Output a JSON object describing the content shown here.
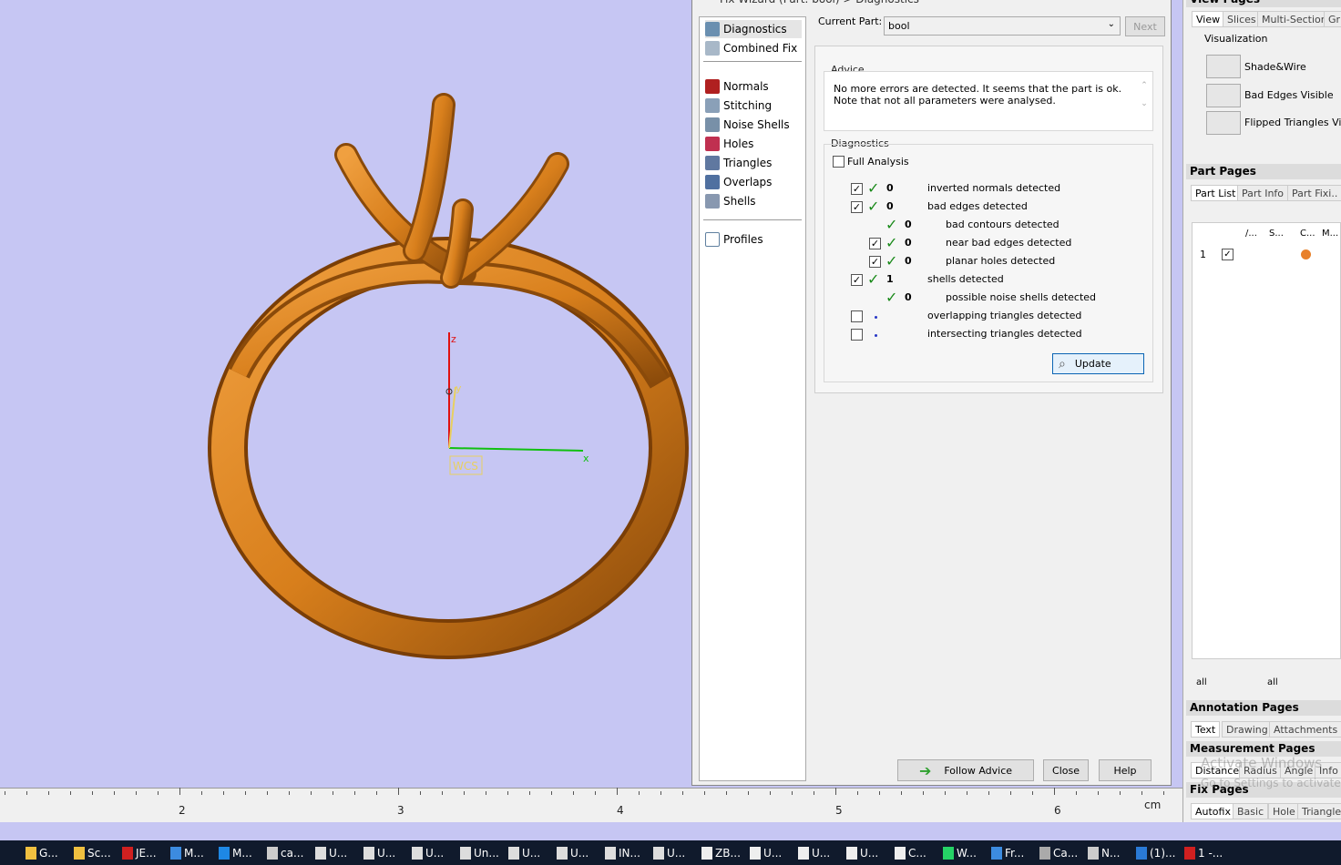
{
  "viewport": {
    "wcs_label": "WCS",
    "axis_x": "x",
    "axis_y": "y",
    "axis_z": "z",
    "ruler_labels": [
      "2",
      "3",
      "4",
      "5",
      "6"
    ],
    "ruler_unit": "cm"
  },
  "wizard": {
    "title": "Fix Wizard (Part: bool) > Diagnostics",
    "nav": [
      "Diagnostics",
      "Combined Fix",
      "Normals",
      "Stitching",
      "Noise Shells",
      "Holes",
      "Triangles",
      "Overlaps",
      "Shells",
      "Profiles"
    ],
    "current_part_label": "Current Part:",
    "current_part_value": "bool",
    "next_label": "Next",
    "advice_label": "Advice",
    "advice_text": "No more errors are detected. It seems that the part is ok. Note that not all parameters were analysed.",
    "diagnostics_label": "Diagnostics",
    "full_analysis_label": "Full Analysis",
    "rows": [
      {
        "count": "0",
        "label": "inverted normals detected"
      },
      {
        "count": "0",
        "label": "bad edges detected"
      },
      {
        "count": "0",
        "label": "bad contours detected"
      },
      {
        "count": "0",
        "label": "near bad edges detected"
      },
      {
        "count": "0",
        "label": "planar holes detected"
      },
      {
        "count": "1",
        "label": "shells detected"
      },
      {
        "count": "0",
        "label": "possible noise shells detected"
      },
      {
        "count": "",
        "label": "overlapping triangles detected"
      },
      {
        "count": "",
        "label": "intersecting triangles detected"
      }
    ],
    "update_label": "Update",
    "follow_advice_label": "Follow Advice",
    "close_label": "Close",
    "help_label": "Help"
  },
  "right": {
    "view_pages": "View Pages",
    "view_tabs": [
      "View",
      "Slices",
      "Multi-Section",
      "Gri"
    ],
    "visualization_label": "Visualization",
    "vis_items": [
      "Shade&Wire",
      "Bad Edges Visible",
      "Flipped Triangles Visibl"
    ],
    "part_pages": "Part Pages",
    "part_tabs": [
      "Part List",
      "Part Info",
      "Part Fixi.."
    ],
    "col_heads": [
      "/...",
      "S...",
      "C...",
      "M..."
    ],
    "row_num": "1",
    "all_labels": [
      "all",
      "all"
    ],
    "annotation_pages": "Annotation Pages",
    "annotation_tabs": [
      "Text",
      "Drawing",
      "Attachments"
    ],
    "measurement_pages": "Measurement Pages",
    "measurement_tabs": [
      "Distance",
      "Radius",
      "Angle",
      "Info"
    ],
    "fix_pages": "Fix Pages",
    "fix_tabs": [
      "Autofix",
      "Basic",
      "Hole",
      "Triangle"
    ],
    "watermark_1": "Activate Windows",
    "watermark_2": "Go to Settings to activate"
  },
  "taskbar": [
    "G...",
    "Sc...",
    "JE...",
    "M...",
    "M...",
    "ca...",
    "U...",
    "U...",
    "U...",
    "Un...",
    "U...",
    "U...",
    "IN...",
    "U...",
    "ZB...",
    "U...",
    "U...",
    "U...",
    "C...",
    "W...",
    "Fr...",
    "Ca...",
    "N...",
    "(1)...",
    "1 -..."
  ]
}
